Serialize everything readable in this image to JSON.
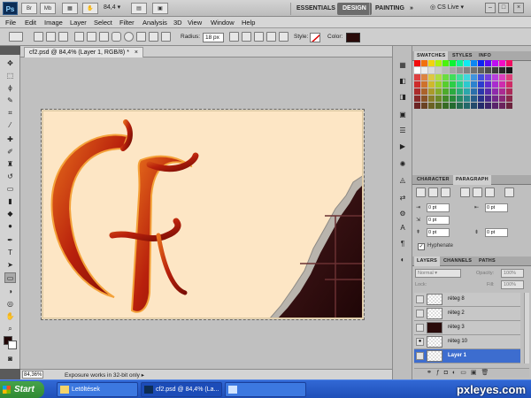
{
  "appbar": {
    "logo": "Ps",
    "br": "Br",
    "mb": "Mb",
    "zoom": "84,4",
    "workspaces": [
      "ESSENTIALS",
      "DESIGN",
      "PAINTING"
    ],
    "active_workspace": "DESIGN",
    "more": "»",
    "cs_live": "CS Live"
  },
  "menu": [
    "File",
    "Edit",
    "Image",
    "Layer",
    "Select",
    "Filter",
    "Analysis",
    "3D",
    "View",
    "Window",
    "Help"
  ],
  "options": {
    "radius_label": "Radius:",
    "radius_value": "18 px",
    "style_label": "Style:",
    "color_label": "Color:",
    "color_value": "#2a0b0a"
  },
  "document": {
    "tab_title": "cf2.psd @ 84,4% (Layer 1, RGB/8) *",
    "close": "×"
  },
  "status": {
    "zoom": "84,36%",
    "message": "Exposure works in 32-bit only"
  },
  "panels": {
    "top_tabs": [
      "SWATCHES",
      "STYLES",
      "INFO"
    ],
    "mid_tabs": [
      "CHARACTER",
      "PARAGRAPH"
    ],
    "para": {
      "values": [
        "0 pt",
        "0 pt",
        "0 pt",
        "0 pt",
        "0 pt"
      ],
      "hyphenate": "Hyphenate"
    },
    "layer_tabs": [
      "LAYERS",
      "CHANNELS",
      "PATHS"
    ],
    "blend_mode": "Normal",
    "opacity_label": "Opacity:",
    "opacity": "100%",
    "lock_label": "Lock:",
    "fill_label": "Fill:",
    "fill": "100%"
  },
  "layers": [
    {
      "name": "réteg 8",
      "visible": false,
      "dark": false
    },
    {
      "name": "réteg 2",
      "visible": false,
      "dark": false
    },
    {
      "name": "réteg 3",
      "visible": false,
      "dark": true
    },
    {
      "name": "réteg 10",
      "visible": true,
      "dark": false
    },
    {
      "name": "Layer 1",
      "visible": false,
      "dark": false,
      "selected": true
    }
  ],
  "taskbar": {
    "start": "Start",
    "tasks": [
      "Letöltések",
      "cf2.psd @ 84,4% (La...",
      " "
    ]
  },
  "watermark": "pxleyes.com",
  "colors": {
    "chocolate": "#2a0b0a",
    "cream": "#fde6c5",
    "letter": "#b8200c",
    "accent": "#3d6dcf"
  }
}
